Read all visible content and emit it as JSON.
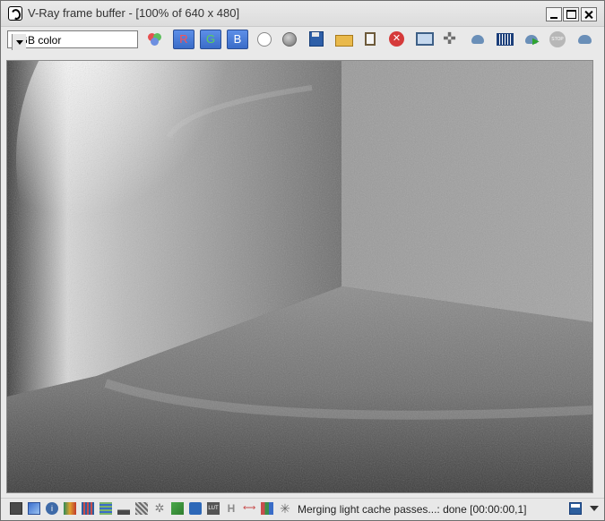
{
  "window": {
    "title": "V-Ray frame buffer - [100% of 640 x 480]"
  },
  "toolbar": {
    "channel_select_value": "RGB color",
    "red_channel_label": "R",
    "green_channel_label": "G",
    "blue_channel_label": "B",
    "icons": [
      "rgb-channels-icon",
      "red-channel-icon",
      "green-channel-icon",
      "blue-channel-icon",
      "white-circle-icon",
      "gray-circle-icon",
      "save-icon",
      "open-folder-icon",
      "clipboard-icon",
      "clear-image-icon",
      "monitor-icon",
      "track-mouse-icon",
      "render-region-icon",
      "histogram-icon",
      "render-icon",
      "stop-icon",
      "render-last-icon"
    ]
  },
  "status": {
    "text": "Merging light cache passes...: done [00:00:00,1]"
  },
  "statusbar_icons": [
    "display-correction-icon",
    "color-corrections-icon",
    "info-icon",
    "exposure-icon",
    "white-balance-icon",
    "hue-saturation-icon",
    "levels-icon",
    "curves-icon",
    "background-icon",
    "lut-icon",
    "ocio-icon",
    "lut-text-icon",
    "h-icon",
    "compare-icon",
    "color-strip-icon",
    "settings-star-icon"
  ],
  "colors": {
    "channel_button": "#3a6cc8",
    "red_label": "#ff5050",
    "green_label": "#59d159",
    "blue_label": "#ffffff"
  }
}
